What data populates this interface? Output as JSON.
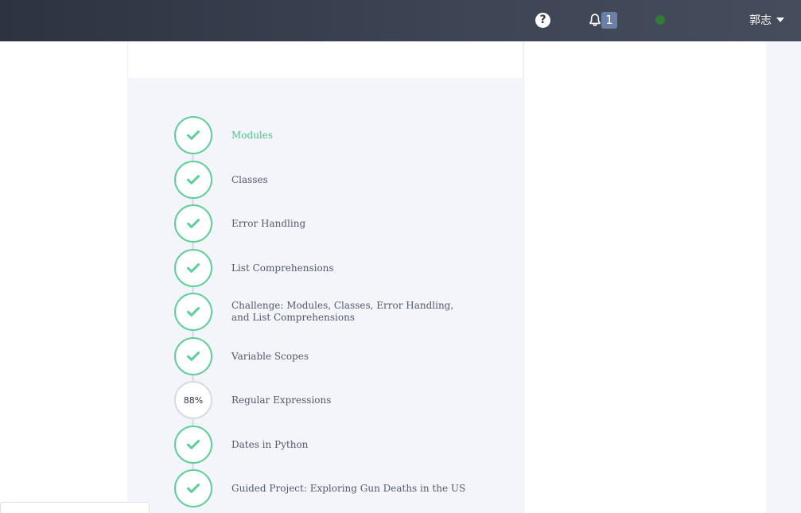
{
  "header": {
    "help_icon": "question-circle-icon",
    "help_label": "?",
    "notifications": {
      "icon": "bell-icon",
      "count": "1"
    },
    "status": {
      "icon": "online-status-dot",
      "color": "#2e7d32"
    },
    "user": {
      "name": "郭志",
      "icon": "caret-down-icon"
    }
  },
  "mission_steps": [
    {
      "label": "Modules",
      "state": "complete",
      "active": true
    },
    {
      "label": "Classes",
      "state": "complete"
    },
    {
      "label": "Error Handling",
      "state": "complete"
    },
    {
      "label": "List Comprehensions",
      "state": "complete"
    },
    {
      "label": "Challenge: Modules, Classes, Error Handling, and List Comprehensions",
      "state": "complete"
    },
    {
      "label": "Variable Scopes",
      "state": "complete"
    },
    {
      "label": "Regular Expressions",
      "state": "in-progress",
      "progress": "88%"
    },
    {
      "label": "Dates in Python",
      "state": "complete"
    },
    {
      "label": "Guided Project: Exploring Gun Deaths in the US",
      "state": "complete"
    }
  ],
  "colors": {
    "complete": "#5fcf98",
    "active_label": "#49c289",
    "label": "#4f5a73",
    "panel_bg": "#f4f5fa"
  }
}
